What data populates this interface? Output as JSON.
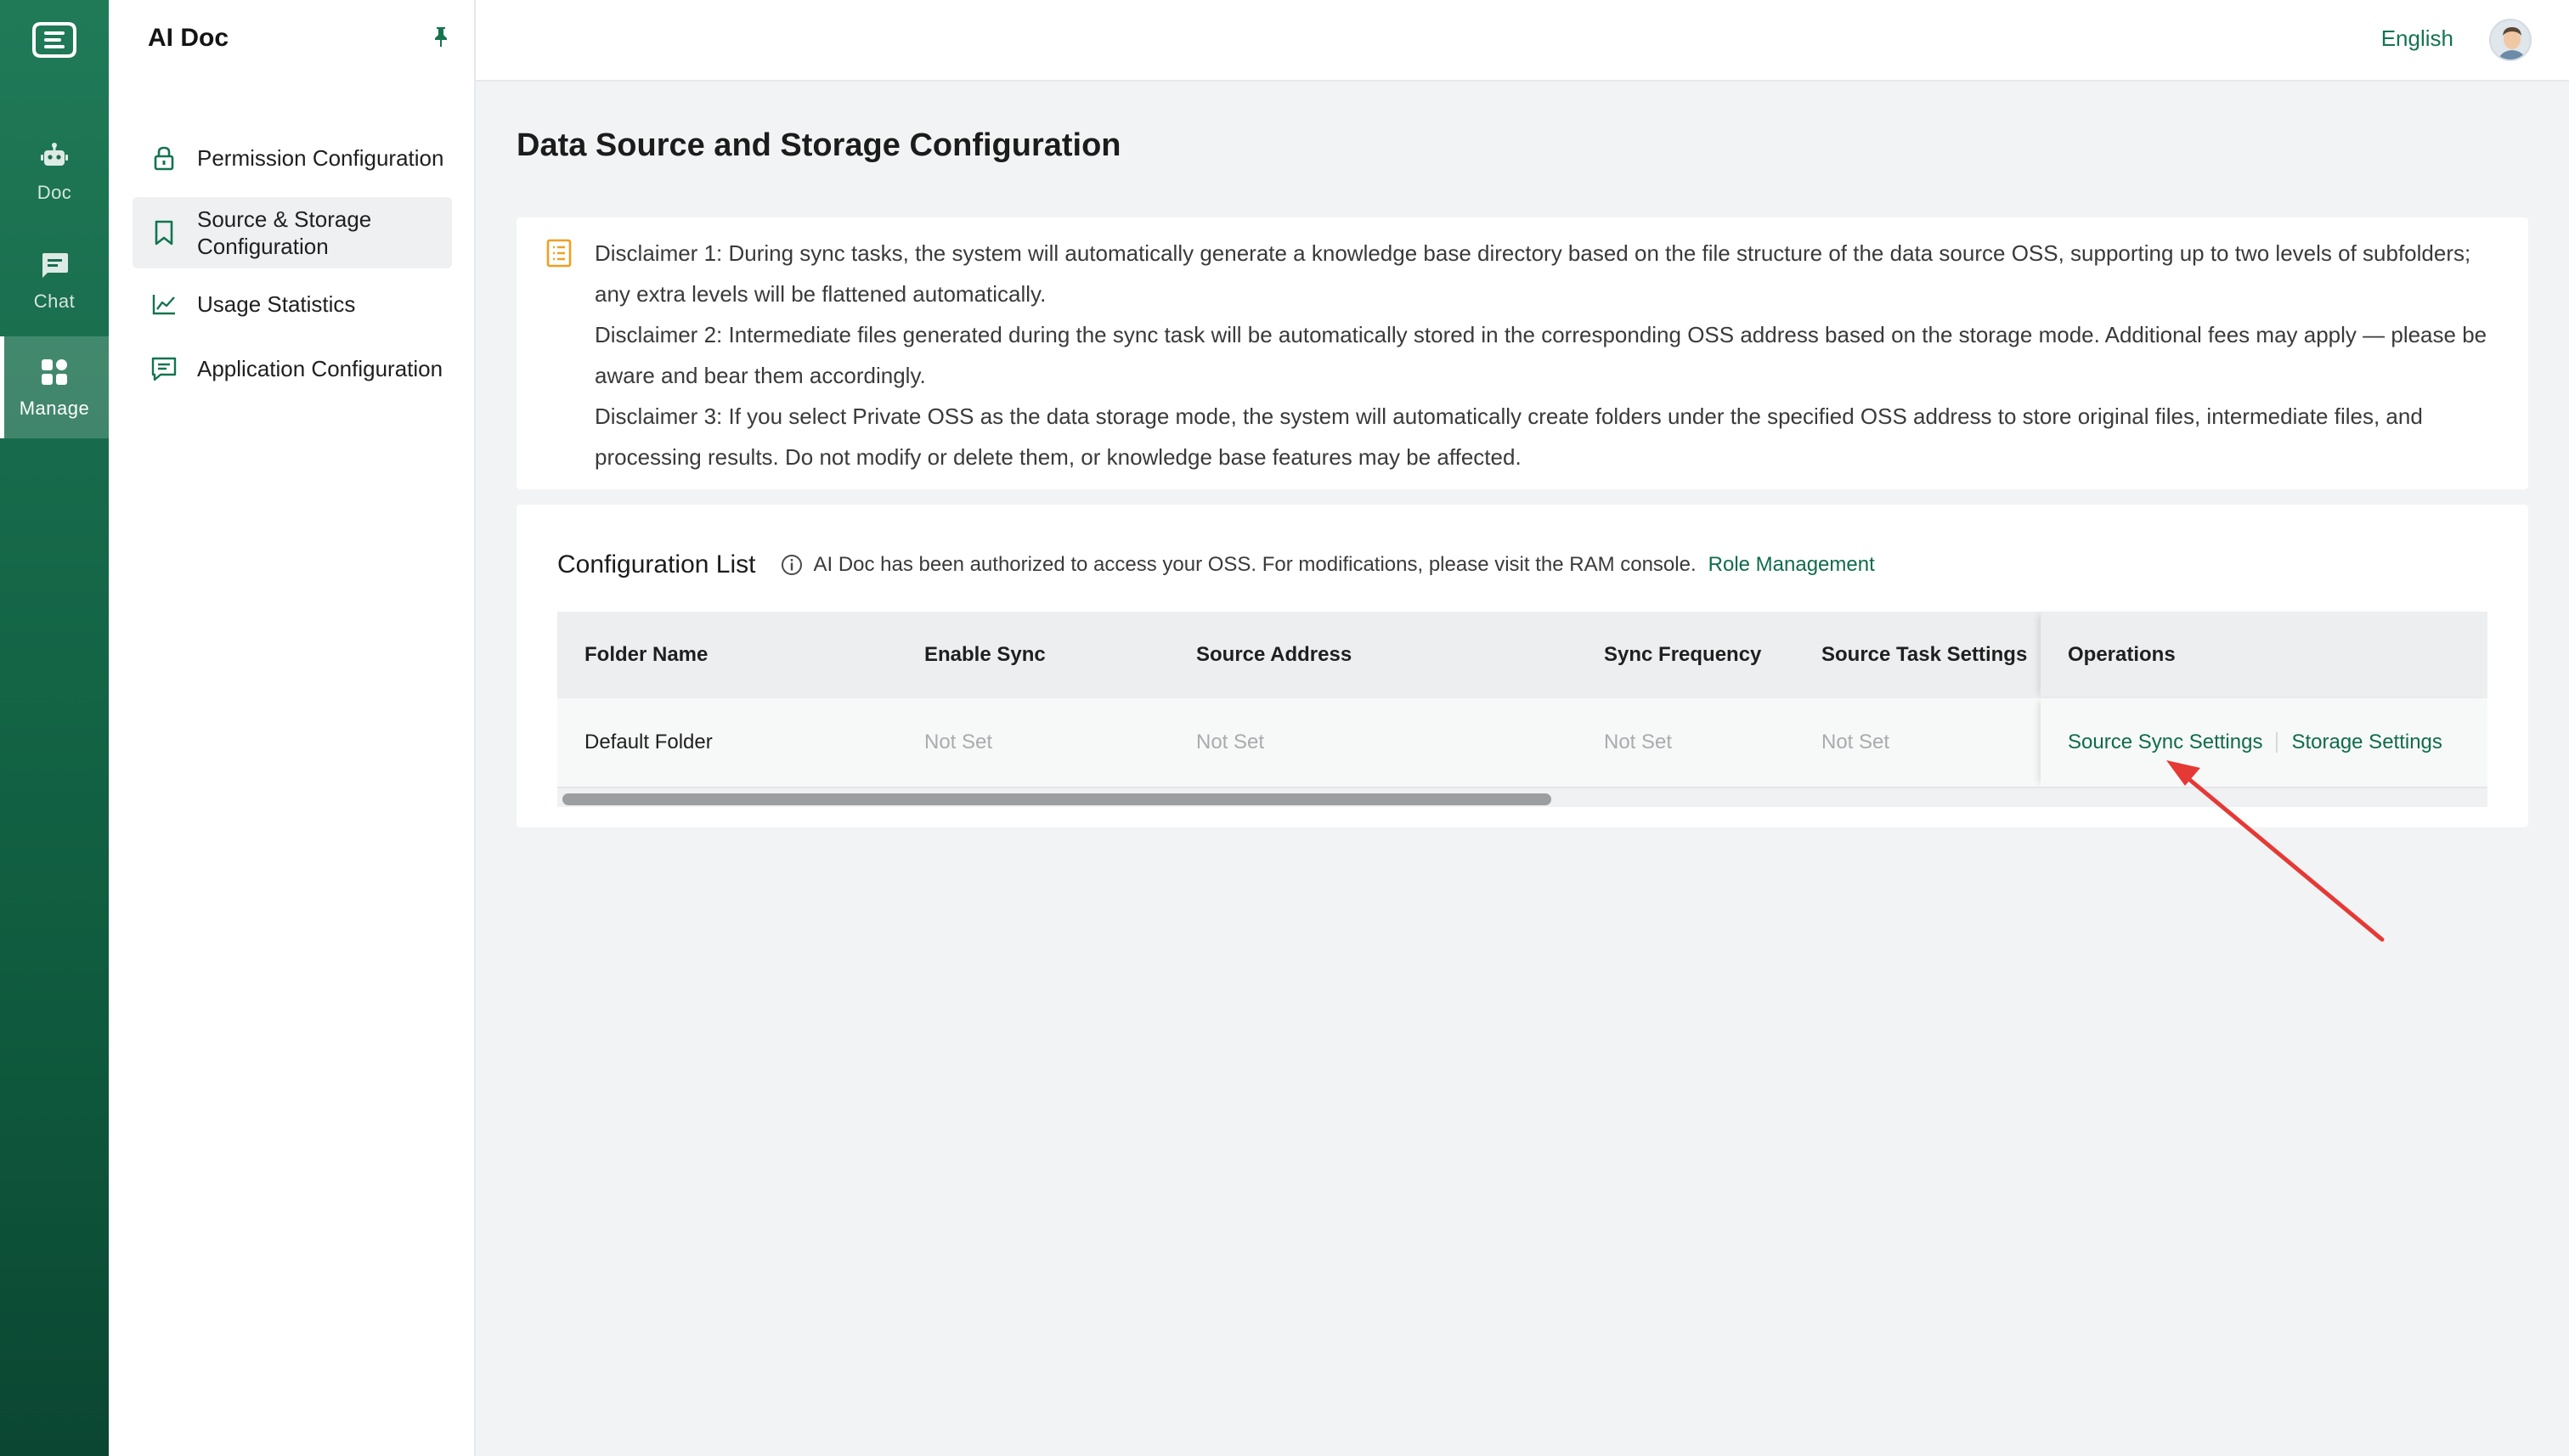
{
  "rail": {
    "items": [
      {
        "label": "Doc",
        "icon": "robot-icon"
      },
      {
        "label": "Chat",
        "icon": "chat-bubble-icon"
      },
      {
        "label": "Manage",
        "icon": "grid-icon"
      }
    ]
  },
  "sidebar": {
    "title": "AI Doc",
    "items": [
      {
        "label": "Permission Configuration",
        "icon": "lock-icon"
      },
      {
        "label": "Source & Storage Configuration",
        "icon": "bookmark-icon"
      },
      {
        "label": "Usage Statistics",
        "icon": "line-chart-icon"
      },
      {
        "label": "Application Configuration",
        "icon": "message-square-icon"
      }
    ]
  },
  "topbar": {
    "language": "English"
  },
  "main": {
    "title": "Data Source and Storage Configuration",
    "disclaimers": [
      "Disclaimer 1: During sync tasks, the system will automatically generate a knowledge base directory based on the file structure of the data source OSS, supporting up to two levels of subfolders; any extra levels will be flattened automatically.",
      "Disclaimer 2: Intermediate files generated during the sync task will be automatically stored in the corresponding OSS address based on the storage mode. Additional fees may apply — please be aware and bear them accordingly.",
      "Disclaimer 3: If you select Private OSS as the data storage mode,  the system will automatically create folders under the specified OSS address to store original files, intermediate files, and processing results. Do not modify or delete them, or knowledge base features may be affected."
    ],
    "config": {
      "title": "Configuration List",
      "note": "AI Doc has been authorized to access your OSS. For modifications, please visit the RAM console.",
      "link": "Role Management",
      "columns": [
        "Folder Name",
        "Enable Sync",
        "Source Address",
        "Sync Frequency",
        "Source Task Settings",
        "Operations"
      ],
      "rows": [
        {
          "folder": "Default Folder",
          "enable_sync": "Not Set",
          "source_address": "Not Set",
          "sync_frequency": "Not Set",
          "task_settings": "Not Set",
          "op_source": "Source Sync Settings",
          "op_storage": "Storage Settings"
        }
      ]
    }
  },
  "colors": {
    "brand": "#14744f",
    "annotation_arrow": "#e53935"
  }
}
